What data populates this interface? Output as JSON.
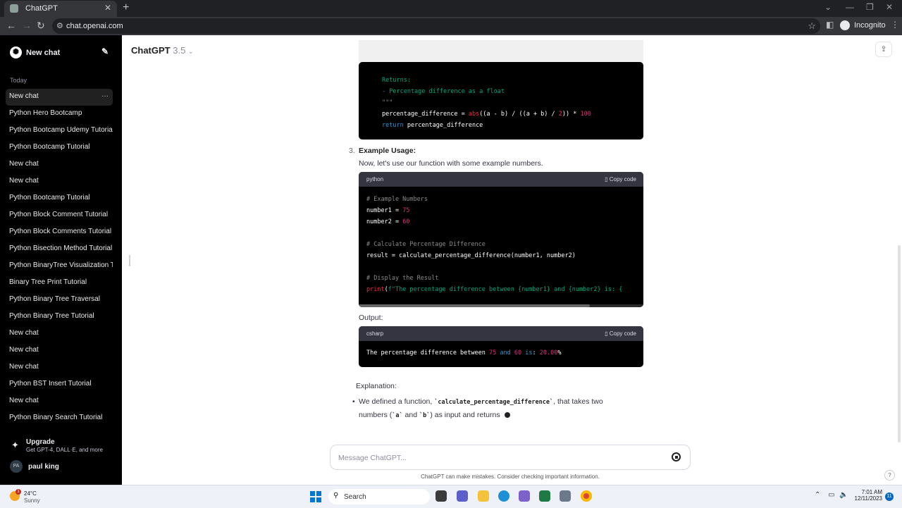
{
  "browser": {
    "tab_title": "ChatGPT",
    "url": "chat.openai.com",
    "incognito_label": "Incognito"
  },
  "sidebar": {
    "new_chat_label": "New chat",
    "section_today": "Today",
    "items": [
      {
        "label": "New chat",
        "active": true
      },
      {
        "label": "Python Hero Bootcamp"
      },
      {
        "label": "Python Bootcamp Udemy Tutorial"
      },
      {
        "label": "Python Bootcamp Tutorial"
      },
      {
        "label": "New chat"
      },
      {
        "label": "New chat"
      },
      {
        "label": "Python Bootcamp Tutorial"
      },
      {
        "label": "Python Block Comment Tutorial"
      },
      {
        "label": "Python Block Comments Tutorial"
      },
      {
        "label": "Python Bisection Method Tutorial"
      },
      {
        "label": "Python BinaryTree Visualization T"
      },
      {
        "label": "Binary Tree Print Tutorial"
      },
      {
        "label": "Python Binary Tree Traversal"
      },
      {
        "label": "Python Binary Tree Tutorial"
      },
      {
        "label": "New chat"
      },
      {
        "label": "New chat"
      },
      {
        "label": "New chat"
      },
      {
        "label": "Python BST Insert Tutorial"
      },
      {
        "label": "New chat"
      },
      {
        "label": "Python Binary Search Tutorial"
      }
    ],
    "upgrade_title": "Upgrade",
    "upgrade_subtitle": "Get GPT-4, DALL·E, and more",
    "user_initials": "PA",
    "user_name": "paul king"
  },
  "header": {
    "model": "ChatGPT",
    "version": "3.5"
  },
  "content": {
    "code1_lines": [
      "Returns:",
      "- Percentage difference as a float",
      "\"\"\"",
      "percentage_difference = abs((a - b) / ((a + b) / 2)) * 100",
      "return percentage_difference"
    ],
    "step3_number": "3.",
    "step3_title": "Example Usage:",
    "step3_text": "Now, let's use our function with some example numbers.",
    "code2": {
      "lang": "python",
      "copy_label": "Copy code",
      "lines": [
        "# Example Numbers",
        "number1 = 75",
        "number2 = 60",
        "",
        "# Calculate Percentage Difference",
        "result = calculate_percentage_difference(number1, number2)",
        "",
        "# Display the Result",
        "print(f\"The percentage difference between {number1} and {number2} is: {"
      ]
    },
    "output_label": "Output:",
    "code3": {
      "lang": "csharp",
      "copy_label": "Copy code",
      "line": "The percentage difference between 75 and 60 is: 20.00%"
    },
    "explanation_label": "Explanation:",
    "bullet_prefix": "We defined a function, ",
    "bullet_code": "`calculate_percentage_difference`",
    "bullet_mid": ", that takes two",
    "bullet_line2_a": "numbers (",
    "bullet_code_a": "`a`",
    "bullet_and": " and ",
    "bullet_code_b": "`b`",
    "bullet_line2_end": ") as input and returns"
  },
  "composer": {
    "placeholder": "Message ChatGPT...",
    "disclaimer": "ChatGPT can make mistakes. Consider checking important information.",
    "help": "?"
  },
  "taskbar": {
    "weather_temp": "24°C",
    "weather_desc": "Sunny",
    "weather_badge": "1",
    "search_label": "Search",
    "time": "7:01 AM",
    "date": "12/11/2023",
    "notif_count": "11"
  }
}
